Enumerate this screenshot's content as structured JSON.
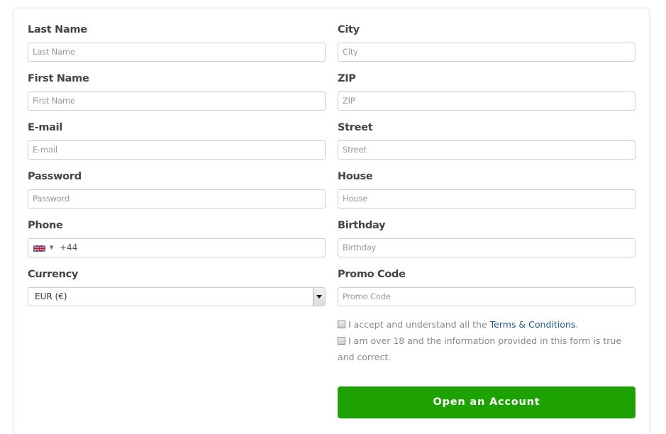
{
  "left_fields": [
    {
      "label": "Last Name",
      "placeholder": "Last Name"
    },
    {
      "label": "First Name",
      "placeholder": "First Name"
    },
    {
      "label": "E-mail",
      "placeholder": "E-mail"
    },
    {
      "label": "Password",
      "placeholder": "Password"
    }
  ],
  "phone": {
    "label": "Phone",
    "flag": "uk-flag-icon",
    "dial_code": "+44"
  },
  "currency": {
    "label": "Currency",
    "selected": "EUR  (€)"
  },
  "right_fields": [
    {
      "label": "City",
      "placeholder": "City"
    },
    {
      "label": "ZIP",
      "placeholder": "ZIP"
    },
    {
      "label": "Street",
      "placeholder": "Street"
    },
    {
      "label": "House",
      "placeholder": "House"
    },
    {
      "label": "Birthday",
      "placeholder": "Birthday"
    },
    {
      "label": "Promo Code",
      "placeholder": "Promo Code"
    }
  ],
  "agreements": {
    "terms_prefix": "I accept and understand all the ",
    "terms_link": "Terms & Conditions",
    "terms_suffix": ".",
    "age_text": "I am over 18 and the information provided in this form is true and correct."
  },
  "submit_label": "Open an Account",
  "colors": {
    "button": "#1ea203",
    "link": "#1f5a8c"
  }
}
